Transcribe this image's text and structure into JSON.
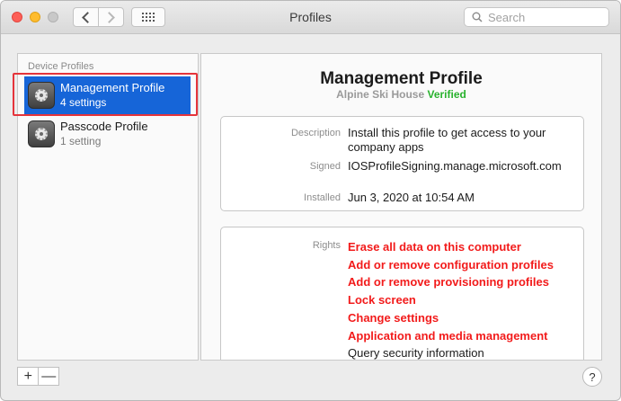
{
  "window": {
    "title": "Profiles",
    "search_placeholder": "Search"
  },
  "sidebar": {
    "header": "Device Profiles",
    "items": [
      {
        "name": "Management Profile",
        "count": "4 settings",
        "selected": true
      },
      {
        "name": "Passcode Profile",
        "count": "1 setting",
        "selected": false
      }
    ],
    "add_label": "+",
    "remove_label": "—"
  },
  "detail": {
    "title": "Management Profile",
    "organization": "Alpine Ski House",
    "status": "Verified",
    "fields": {
      "description_label": "Description",
      "description_value": "Install this profile to get access to your company apps",
      "signed_label": "Signed",
      "signed_value": "IOSProfileSigning.manage.microsoft.com",
      "installed_label": "Installed",
      "installed_value": "Jun 3, 2020 at 10:54 AM"
    },
    "rights_label": "Rights",
    "rights": [
      "Erase all data on this computer",
      "Add or remove configuration profiles",
      "Add or remove provisioning profiles",
      "Lock screen",
      "Change settings",
      "Application and media management",
      "Query security information"
    ]
  },
  "help_label": "?",
  "colors": {
    "selection": "#1665d8",
    "warning_text": "#f21b1b",
    "verified": "#28b22d",
    "annotation_box": "#e5343b"
  }
}
